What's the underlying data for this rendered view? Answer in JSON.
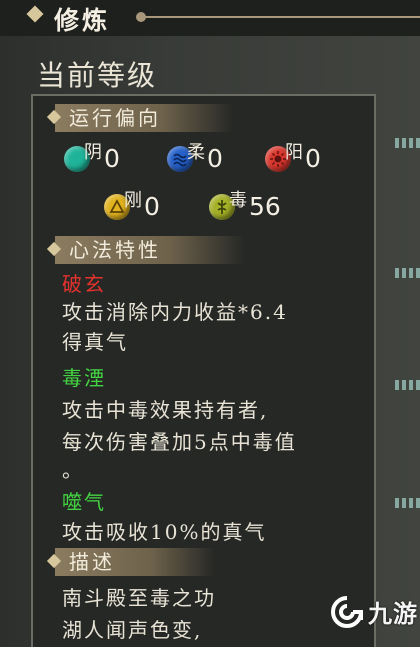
{
  "header": {
    "title": "修炼"
  },
  "level": {
    "title": "当前等级"
  },
  "orientation": {
    "label": "运行偏向",
    "elements": [
      {
        "label": "阴",
        "value": "0",
        "color": "#1fb49a",
        "icon": "crescent-icon"
      },
      {
        "label": "柔",
        "value": "0",
        "color": "#2560c8",
        "icon": "wave-icon"
      },
      {
        "label": "阳",
        "value": "0",
        "color": "#d9372e",
        "icon": "sun-icon"
      },
      {
        "label": "刚",
        "value": "0",
        "color": "#e1b21e",
        "icon": "triangle-icon"
      },
      {
        "label": "毒",
        "value": "56",
        "color": "#a5b126",
        "icon": "poison-icon"
      }
    ]
  },
  "traits": {
    "label": "心法特性",
    "items": [
      {
        "name": "破玄",
        "name_color": "#e4322d",
        "lines": [
          "攻击消除内力收益*6.4",
          "得真气"
        ]
      },
      {
        "name": "毒湮",
        "name_color": "#43d441",
        "lines": [
          "攻击中毒效果持有者,",
          "每次伤害叠加5点中毒值",
          "。"
        ]
      },
      {
        "name": "噬气",
        "name_color": "#43d441",
        "lines": [
          "攻击吸收10%的真气"
        ]
      }
    ]
  },
  "description": {
    "label": "描述",
    "lines": [
      "南斗殿至毒之功",
      "湖人闻声色变,"
    ]
  },
  "watermark": {
    "text": "九游"
  }
}
